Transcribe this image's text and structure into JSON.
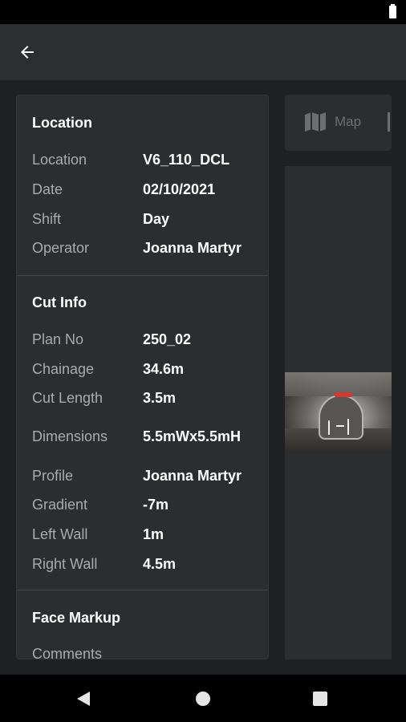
{
  "location_section": {
    "title": "Location",
    "rows": [
      {
        "label": "Location",
        "value": "V6_110_DCL"
      },
      {
        "label": "Date",
        "value": "02/10/2021"
      },
      {
        "label": "Shift",
        "value": "Day"
      },
      {
        "label": "Operator",
        "value": "Joanna Martyr"
      }
    ]
  },
  "cut_info_section": {
    "title": "Cut Info",
    "rows": [
      {
        "label": "Plan No",
        "value": "250_02"
      },
      {
        "label": "Chainage",
        "value": "34.6m"
      },
      {
        "label": "Cut Length",
        "value": "3.5m"
      },
      {
        "label": "Dimensions",
        "value": "5.5mWx5.5mH"
      },
      {
        "label": "Profile",
        "value": "Joanna Martyr"
      },
      {
        "label": "Gradient",
        "value": "-7m"
      },
      {
        "label": "Left Wall",
        "value": "1m"
      },
      {
        "label": "Right Wall",
        "value": "4.5m"
      }
    ]
  },
  "face_markup_section": {
    "title": "Face Markup",
    "comments_label": "Comments"
  },
  "tabs": {
    "map_label": "Map"
  },
  "icons": {
    "back": "arrow-left-icon",
    "map": "map-icon",
    "battery": "battery-icon"
  },
  "colors": {
    "background": "#1f2022",
    "panel": "#2c2d30",
    "label": "#a9abaf",
    "value": "#ffffff"
  }
}
